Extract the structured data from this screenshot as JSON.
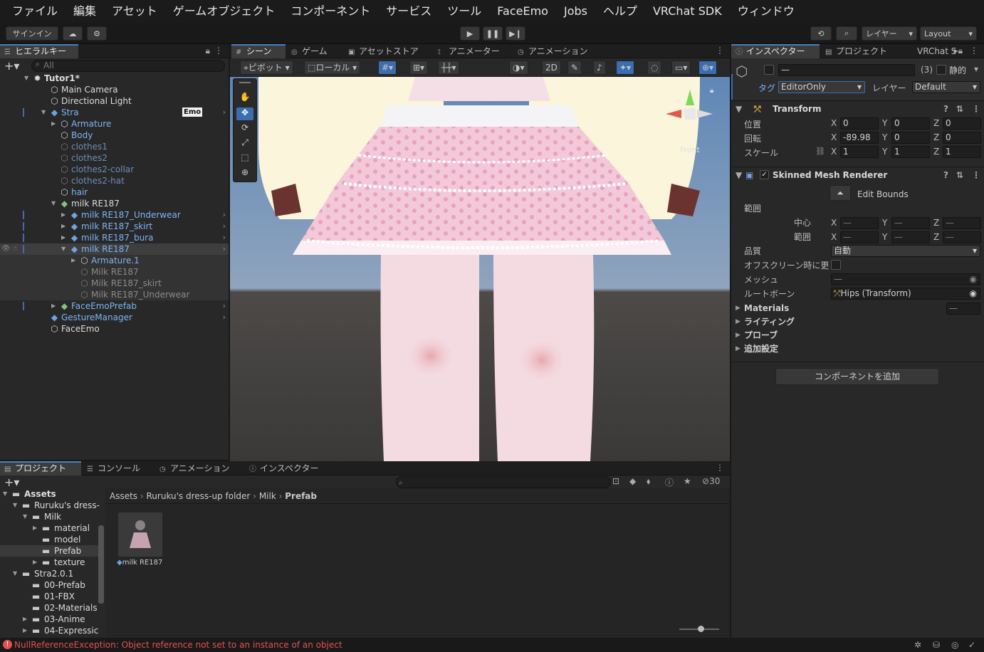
{
  "menubar": [
    "ファイル",
    "編集",
    "アセット",
    "ゲームオブジェクト",
    "コンポーネント",
    "サービス",
    "ツール",
    "FaceEmo",
    "Jobs",
    "ヘルプ",
    "VRChat SDK",
    "ウィンドウ"
  ],
  "toolbar": {
    "signin": "サインイン",
    "layer": "レイヤー",
    "layout": "Layout"
  },
  "hierarchy": {
    "tab": "ヒエラルキー",
    "search_placeholder": "All",
    "rows": [
      {
        "label": "Tutor1*",
        "indent": 0,
        "color": "white",
        "arrow": "▼",
        "icon": "scene",
        "bold": true
      },
      {
        "label": "Main Camera",
        "indent": 1,
        "color": "white",
        "icon": "cube"
      },
      {
        "label": "Directional Light",
        "indent": 1,
        "color": "white",
        "icon": "cube"
      },
      {
        "label": "Stra",
        "indent": 1,
        "color": "blue",
        "arrow": "▼",
        "icon": "prefab",
        "badge": "Emo",
        "chev": true
      },
      {
        "label": "Armature",
        "indent": 2,
        "color": "blue",
        "arrow": "▶",
        "icon": "cube"
      },
      {
        "label": "Body",
        "indent": 2,
        "color": "blue",
        "icon": "cube"
      },
      {
        "label": "clothes1",
        "indent": 2,
        "color": "dim",
        "icon": "cube"
      },
      {
        "label": "clothes2",
        "indent": 2,
        "color": "dim",
        "icon": "cube"
      },
      {
        "label": "clothes2-collar",
        "indent": 2,
        "color": "dim",
        "icon": "cube"
      },
      {
        "label": "clothes2-hat",
        "indent": 2,
        "color": "dim",
        "icon": "cube"
      },
      {
        "label": "hair",
        "indent": 2,
        "color": "blue",
        "icon": "cube"
      },
      {
        "label": "milk RE187",
        "indent": 2,
        "color": "white",
        "arrow": "▼",
        "icon": "prefab-green"
      },
      {
        "label": "milk RE187_Underwear",
        "indent": 3,
        "color": "blue",
        "arrow": "▶",
        "icon": "prefab",
        "chev": true
      },
      {
        "label": "milk RE187_skirt",
        "indent": 3,
        "color": "blue",
        "arrow": "▶",
        "icon": "prefab",
        "chev": true
      },
      {
        "label": "milk RE187_bura",
        "indent": 3,
        "color": "blue",
        "arrow": "▶",
        "icon": "prefab",
        "chev": true
      },
      {
        "label": "milk RE187",
        "indent": 3,
        "color": "blue",
        "arrow": "▼",
        "icon": "prefab",
        "chev": true,
        "selected": true
      },
      {
        "label": "Armature.1",
        "indent": 4,
        "color": "blue",
        "arrow": "▶",
        "icon": "cube",
        "hl": true
      },
      {
        "label": "Milk RE187",
        "indent": 4,
        "color": "gray",
        "icon": "cube",
        "hl": true
      },
      {
        "label": "Milk RE187_skirt",
        "indent": 4,
        "color": "gray",
        "icon": "cube",
        "hl": true
      },
      {
        "label": "Milk RE187_Underwear",
        "indent": 4,
        "color": "gray",
        "icon": "cube",
        "hl": true
      },
      {
        "label": "FaceEmoPrefab",
        "indent": 2,
        "color": "blue",
        "arrow": "▶",
        "icon": "prefab-green",
        "chev": true
      },
      {
        "label": "GestureManager",
        "indent": 1,
        "color": "blue",
        "icon": "prefab",
        "chev": true
      },
      {
        "label": "FaceEmo",
        "indent": 1,
        "color": "white",
        "icon": "cube"
      }
    ]
  },
  "scene": {
    "tabs": [
      "シーン",
      "ゲーム",
      "アセットストア",
      "アニメーター",
      "アニメーション"
    ],
    "pivot": "ピボット",
    "local": "ローカル",
    "mode2d": "2D",
    "gizmo_label": "Front"
  },
  "inspector": {
    "tabs": [
      "インスペクター",
      "プロジェクト",
      "VRChat S"
    ],
    "name_value": "—",
    "count": "(3)",
    "static_label": "静的",
    "tag_label": "タグ",
    "tag_value": "EditorOnly",
    "layer_label": "レイヤー",
    "layer_value": "Default",
    "transform": {
      "title": "Transform",
      "position_label": "位置",
      "rotation_label": "回転",
      "scale_label": "スケール",
      "position": [
        "0",
        "0",
        "0"
      ],
      "rotation": [
        "-89.98",
        "0",
        "0"
      ],
      "scale": [
        "1",
        "1",
        "1"
      ]
    },
    "smr": {
      "title": "Skinned Mesh Renderer",
      "edit_bounds": "Edit Bounds",
      "bounds_label": "範囲",
      "center_label": "中心",
      "extent_label": "範囲",
      "dash": "—",
      "quality_label": "品質",
      "quality_value": "自動",
      "offscreen_label": "オフスクリーン時に更",
      "mesh_label": "メッシュ",
      "mesh_value": "—",
      "rootbone_label": "ルートボーン",
      "rootbone_value": "Hips (Transform)"
    },
    "sections": [
      "Materials",
      "ライティング",
      "プローブ",
      "追加設定"
    ],
    "materials_value": "—",
    "add_component": "コンポーネントを追加"
  },
  "project": {
    "tabs": [
      "プロジェクト",
      "コンソール",
      "アニメーション",
      "インスペクター"
    ],
    "hidden_count": "30",
    "tree": [
      {
        "label": "Assets",
        "indent": 0,
        "arrow": "▼",
        "bold": true
      },
      {
        "label": "Ruruku's dress-",
        "indent": 1,
        "arrow": "▼"
      },
      {
        "label": "Milk",
        "indent": 2,
        "arrow": "▼"
      },
      {
        "label": "material",
        "indent": 3,
        "arrow": "▶"
      },
      {
        "label": "model",
        "indent": 3
      },
      {
        "label": "Prefab",
        "indent": 3,
        "selected": true
      },
      {
        "label": "texture",
        "indent": 3,
        "arrow": "▶"
      },
      {
        "label": "Stra2.0.1",
        "indent": 1,
        "arrow": "▼"
      },
      {
        "label": "00-Prefab",
        "indent": 2
      },
      {
        "label": "01-FBX",
        "indent": 2
      },
      {
        "label": "02-Materials",
        "indent": 2
      },
      {
        "label": "03-Anime",
        "indent": 2,
        "arrow": "▶"
      },
      {
        "label": "04-Expressic",
        "indent": 2,
        "arrow": "▶"
      }
    ],
    "breadcrumb": [
      "Assets",
      "Ruruku's dress-up folder",
      "Milk",
      "Prefab"
    ],
    "asset_label": "milk RE187"
  },
  "status": {
    "error": "NullReferenceException: Object reference not set to an instance of an object"
  },
  "colors": {
    "accent": "#3b6db0",
    "error": "#e05252",
    "blue_text": "#7eb3f5"
  }
}
